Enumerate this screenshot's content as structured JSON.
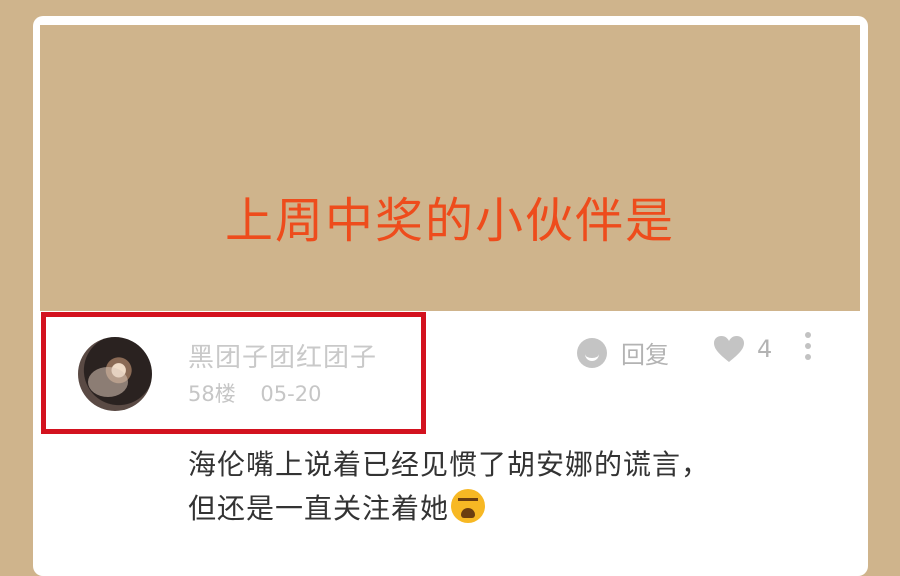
{
  "banner": {
    "title": "上周中奖的小伙伴是"
  },
  "comment": {
    "username": "黑团子团红团子",
    "floor": "58楼",
    "date": "05-20",
    "reply_label": "回复",
    "like_count": "4",
    "text_line1": "海伦嘴上说着已经见惯了胡安娜的谎言，",
    "text_line2": "但还是一直关注着她",
    "emoji": "crying-face"
  },
  "colors": {
    "background": "#cfb48c",
    "title": "#ee4c1c",
    "highlight": "#d3121f"
  }
}
